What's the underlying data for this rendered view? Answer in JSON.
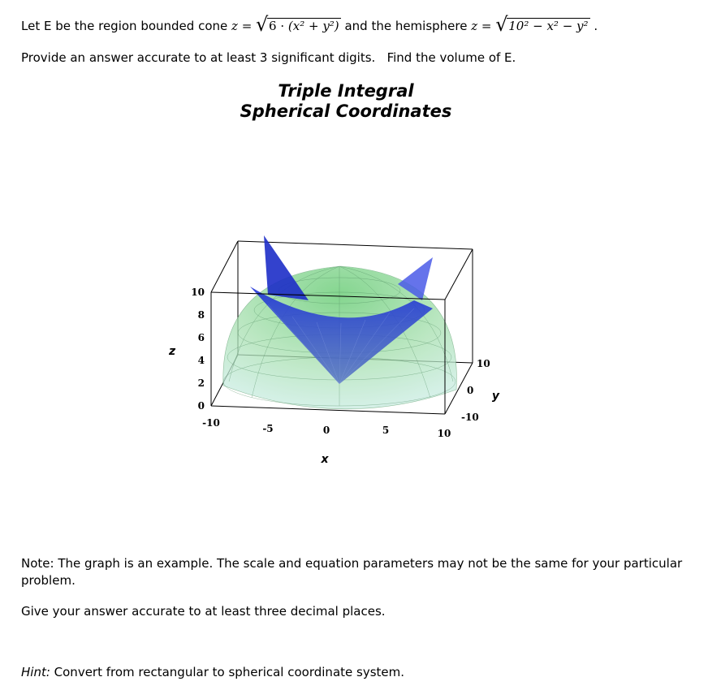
{
  "problem": {
    "line1_prefix": "Let E be the region bounded cone ",
    "cone_lhs": "z",
    "eq": " = ",
    "cone_coef": "6",
    "cone_dot": " · ",
    "cone_inner": "(x² + y²)",
    "line1_middle": " and the hemisphere ",
    "hemi_lhs": "z",
    "hemi_radicand": "10² − x² − y²",
    "line1_suffix": " .",
    "line2": "Provide an answer accurate to at least 3 significant digits.   Find the volume of E."
  },
  "figure": {
    "title_line1": "Triple Integral",
    "title_line2": "Spherical Coordinates",
    "z_axis_label": "z",
    "x_axis_label": "x",
    "y_axis_label": "y",
    "z_ticks": [
      "0",
      "2",
      "4",
      "6",
      "8",
      "10"
    ],
    "x_ticks": [
      "-10",
      "-5",
      "0",
      "5",
      "10"
    ],
    "y_ticks": [
      "-10",
      "0",
      "10"
    ],
    "colors": {
      "hemisphere": "#7fd08a",
      "cone": "#2a3fd0",
      "box": "#000000"
    }
  },
  "notes": {
    "note": "Note:  The graph is an example.  The scale and equation parameters may not be the same for your particular problem.",
    "decimal": "Give your answer accurate to at least three decimal places.",
    "hint_label": "Hint:",
    "hint_text": " Convert from rectangular to spherical coordinate system."
  }
}
